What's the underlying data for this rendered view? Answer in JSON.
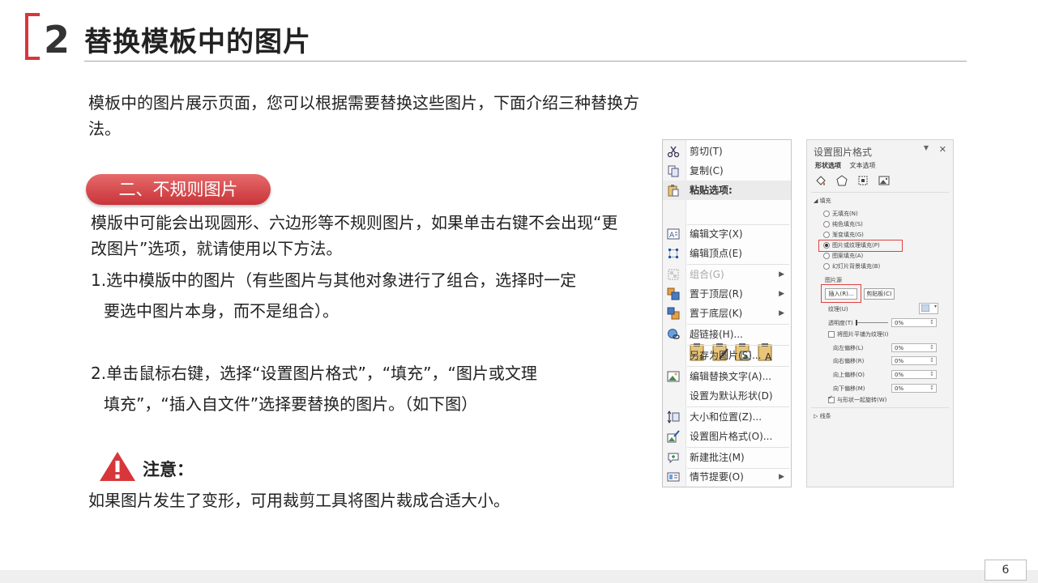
{
  "header": {
    "number": "2",
    "title": "替换模板中的图片"
  },
  "intro": "模板中的图片展示页面，您可以根据需要替换这些图片，下面介绍三种替换方法。",
  "section": {
    "pill": "二、不规则图片",
    "desc": "模版中可能会出现圆形、六边形等不规则图片，如果单击右键不会出现“更改图片”选项，就请使用以下方法。",
    "step1_a": "1.选中模版中的图片（有些图片与其他对象进行了组合，选择时一定",
    "step1_b": "要选中图片本身，而不是组合）。",
    "step2_a": "2.单击鼠标右键，选择“设置图片格式”，“填充”，“图片或文理",
    "step2_b": "填充”，“插入自文件”选择要替换的图片。（如下图）"
  },
  "notice": {
    "label": "注意：",
    "text": "如果图片发生了变形，可用裁剪工具将图片裁成合适大小。"
  },
  "context_menu": {
    "items": [
      {
        "label": "剪切(T)",
        "icon": "scissors-icon"
      },
      {
        "label": "复制(C)",
        "icon": "copy-icon"
      },
      {
        "label": "粘贴选项:",
        "icon": "paste-icon"
      },
      {
        "label": "编辑文字(X)",
        "icon": "edit-text-icon"
      },
      {
        "label": "编辑顶点(E)",
        "icon": "edit-points-icon"
      },
      {
        "label": "组合(G)",
        "icon": "group-icon"
      },
      {
        "label": "置于顶层(R)",
        "icon": "bring-front-icon"
      },
      {
        "label": "置于底层(K)",
        "icon": "send-back-icon"
      },
      {
        "label": "超链接(H)...",
        "icon": "hyperlink-icon"
      },
      {
        "label": "另存为图片(S)...",
        "icon": ""
      },
      {
        "label": "编辑替换文字(A)...",
        "icon": "alt-text-icon"
      },
      {
        "label": "设置为默认形状(D)",
        "icon": ""
      },
      {
        "label": "大小和位置(Z)...",
        "icon": "size-position-icon"
      },
      {
        "label": "设置图片格式(O)...",
        "icon": "format-picture-icon"
      },
      {
        "label": "新建批注(M)",
        "icon": "comment-icon"
      },
      {
        "label": "情节提要(O)",
        "icon": "storyboard-icon"
      }
    ]
  },
  "format_panel": {
    "title": "设置图片格式",
    "tabs": [
      "形状选项",
      "文本选项"
    ],
    "fill_header": "填充",
    "fill_options": [
      "无填充(N)",
      "纯色填充(S)",
      "渐变填充(G)",
      "图片或纹理填充(P)",
      "图案填充(A)",
      "幻灯片背景填充(B)"
    ],
    "picture_source": "图片源",
    "insert_btn": "插入(R)...",
    "clipboard_btn": "剪贴板(C)",
    "texture": "纹理(U)",
    "transparency": "透明度(T)",
    "transparency_val": "0%",
    "tile_label": "将图片平铺为纹理(I)",
    "offsets": [
      {
        "label": "向左偏移(L)",
        "value": "0%"
      },
      {
        "label": "向右偏移(R)",
        "value": "0%"
      },
      {
        "label": "向上偏移(O)",
        "value": "0%"
      },
      {
        "label": "向下偏移(M)",
        "value": "0%"
      }
    ],
    "rotate_label": "与形状一起旋转(W)",
    "line_header": "线条"
  },
  "footer": {
    "page": "6"
  }
}
